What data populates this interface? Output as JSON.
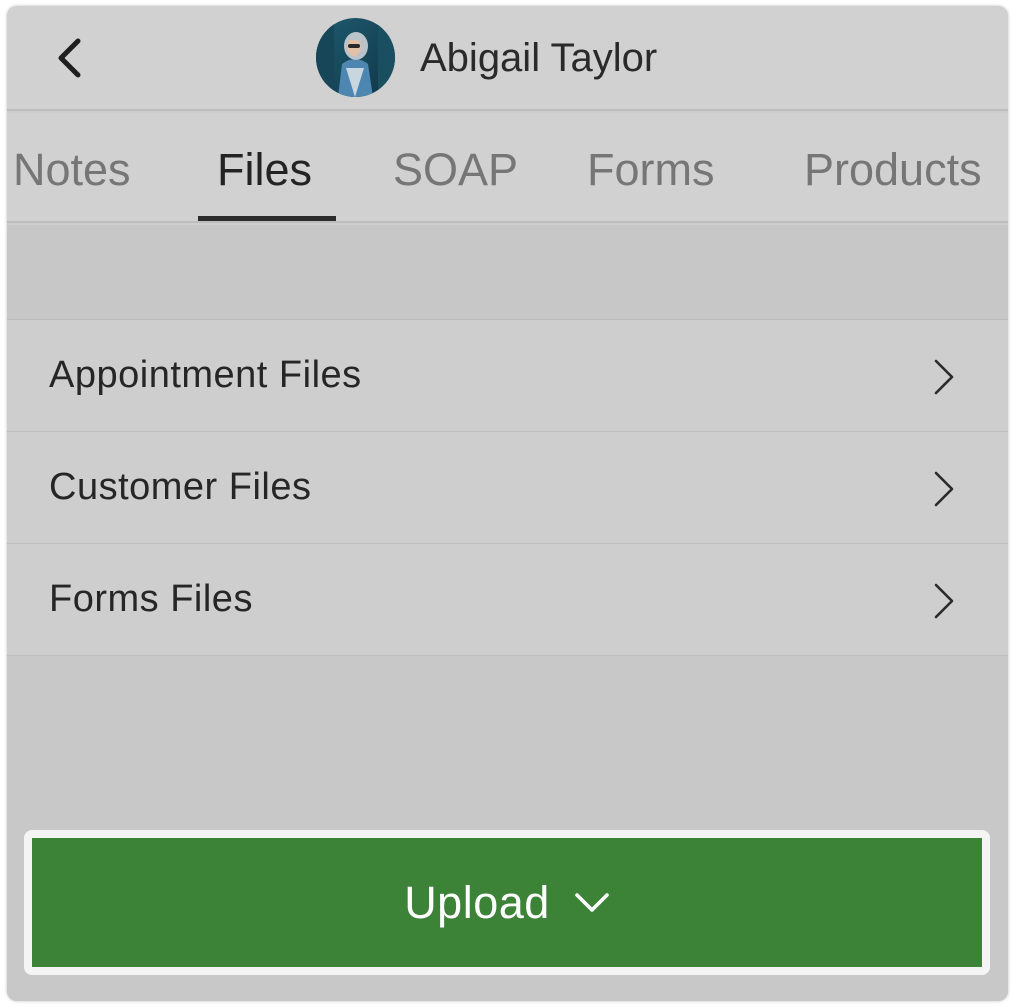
{
  "header": {
    "back_icon": "chevron-left-icon",
    "avatar_icon": "user-avatar-photo",
    "user_name": "Abigail Taylor"
  },
  "tabs": [
    {
      "label": "Notes",
      "active": false
    },
    {
      "label": "Files",
      "active": true
    },
    {
      "label": "SOAP",
      "active": false
    },
    {
      "label": "Forms",
      "active": false
    },
    {
      "label": "Products",
      "active": false
    }
  ],
  "file_categories": [
    {
      "label": "Appointment Files",
      "icon": "chevron-right-icon"
    },
    {
      "label": "Customer Files",
      "icon": "chevron-right-icon"
    },
    {
      "label": "Forms Files",
      "icon": "chevron-right-icon"
    }
  ],
  "upload": {
    "label": "Upload",
    "icon": "chevron-down-icon",
    "color": "#3c8338"
  },
  "colors": {
    "background": "#cdcdcd",
    "accent": "#3c8338",
    "active_tab": "#232323",
    "inactive_tab": "#767676"
  }
}
